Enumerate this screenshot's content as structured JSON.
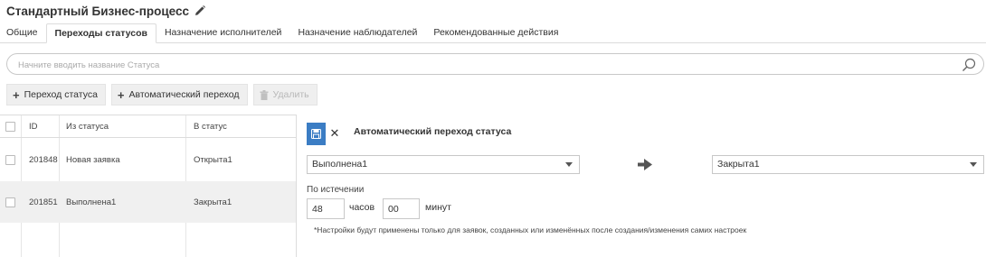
{
  "header": {
    "title": "Стандартный Бизнес-процесс"
  },
  "tabs": [
    {
      "label": "Общие"
    },
    {
      "label": "Переходы статусов",
      "active": true
    },
    {
      "label": "Назначение исполнителей"
    },
    {
      "label": "Назначение наблюдателей"
    },
    {
      "label": "Рекомендованные действия"
    }
  ],
  "search": {
    "placeholder": "Начните вводить название Статуса"
  },
  "toolbar": {
    "add_transition": "Переход статуса",
    "add_auto_transition": "Автоматический переход",
    "delete": "Удалить"
  },
  "table": {
    "columns": {
      "id": "ID",
      "from": "Из статуса",
      "to": "В статус"
    },
    "rows": [
      {
        "id": "201848",
        "from": "Новая заявка",
        "to": "Открыта1"
      },
      {
        "id": "201851",
        "from": "Выполнена1",
        "to": "Закрыта1",
        "selected": true
      }
    ]
  },
  "panel": {
    "title": "Автоматический переход статуса",
    "from_status": "Выполнена1",
    "to_status": "Закрыта1",
    "expiry_label": "По истечении",
    "hours_value": "48",
    "hours_unit": "часов",
    "minutes_value": "00",
    "minutes_unit": "минут",
    "note": "*Настройки будут применены только для заявок, созданных или изменённых после создания/изменения самих настроек"
  },
  "colors": {
    "accent": "#3b7dc4",
    "selected_row": "#f0f0f0",
    "border": "#dcdcdc"
  }
}
